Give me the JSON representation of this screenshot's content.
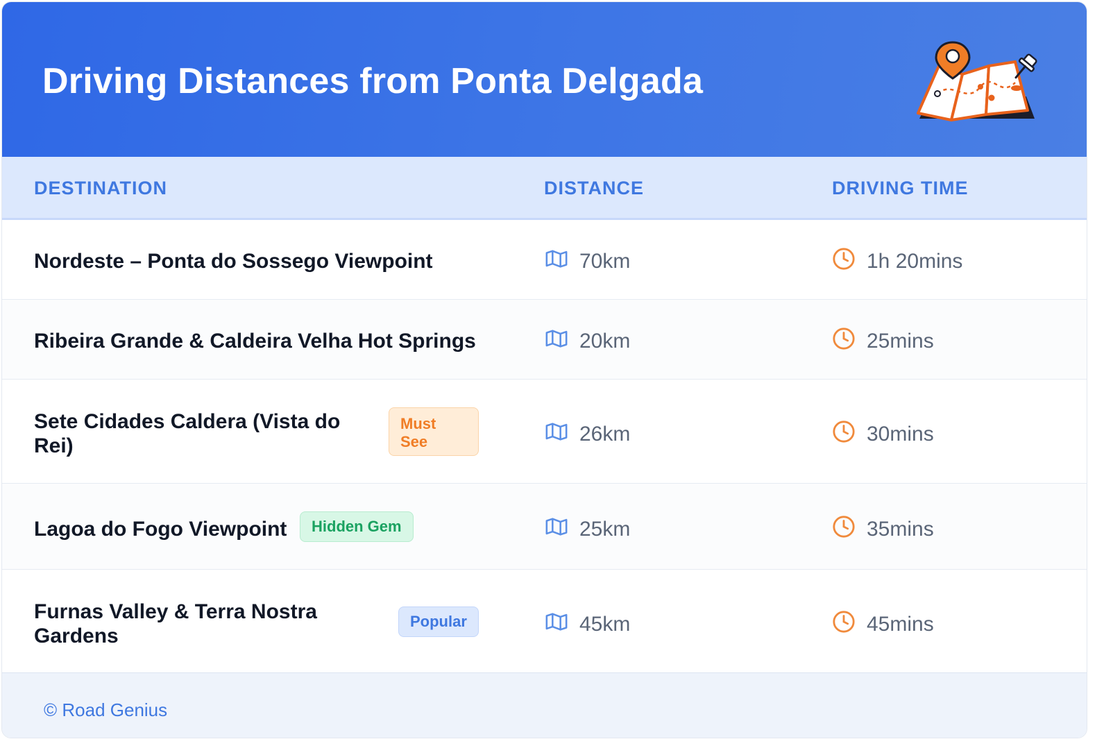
{
  "header": {
    "title": "Driving Distances from Ponta Delgada",
    "illustration": "folded-map-with-location-pin-icon"
  },
  "table": {
    "columns": [
      "DESTINATION",
      "DISTANCE",
      "DRIVING TIME"
    ],
    "distance_icon": "map-icon",
    "time_icon": "clock-icon",
    "rows": [
      {
        "destination": "Nordeste – Ponta do Sossego Viewpoint",
        "badge": "",
        "distance": "70km",
        "time": "1h 20mins"
      },
      {
        "destination": "Ribeira Grande & Caldeira Velha Hot Springs",
        "badge": "",
        "distance": "20km",
        "time": "25mins"
      },
      {
        "destination": "Sete Cidades Caldera (Vista do Rei)",
        "badge": "Must See",
        "distance": "26km",
        "time": "30mins"
      },
      {
        "destination": "Lagoa do Fogo Viewpoint",
        "badge": "Hidden Gem",
        "distance": "25km",
        "time": "35mins"
      },
      {
        "destination": "Furnas Valley & Terra Nostra Gardens",
        "badge": "Popular",
        "distance": "45km",
        "time": "45mins"
      }
    ]
  },
  "footer": {
    "text": "© Road Genius"
  },
  "colors": {
    "header_bg": "#3068e6",
    "accent_blue": "#3f78e0",
    "accent_orange": "#f07d26",
    "accent_green": "#1aa261",
    "text_dark": "#111827",
    "text_muted": "#5a6577"
  }
}
